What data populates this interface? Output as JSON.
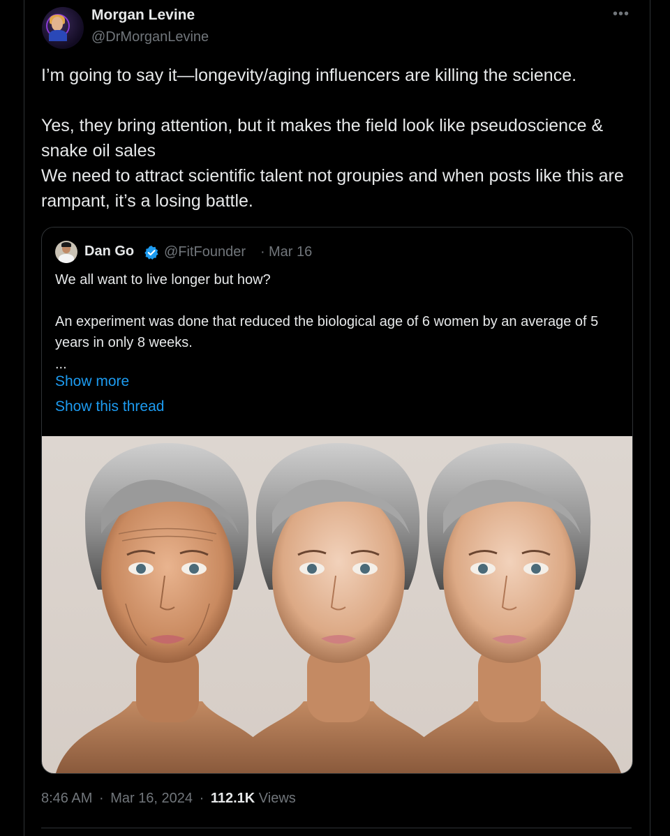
{
  "post": {
    "author": {
      "name": "Morgan Levine",
      "handle": "@DrMorganLevine"
    },
    "more_icon": "more-horizontal-icon",
    "text": {
      "p1": "I’m going to say it—longevity/aging influencers are killing the science.",
      "p2": "Yes, they bring attention, but it makes the field look like pseudoscience & snake oil sales",
      "p3": "We need to attract scientific talent not groupies and when posts like this are rampant, it’s a losing battle."
    },
    "meta": {
      "time": "8:46 AM",
      "separator": "·",
      "date": "Mar 16, 2024",
      "views_count": "112.1K",
      "views_label": "Views"
    }
  },
  "quote": {
    "author": {
      "name": "Dan Go",
      "handle": "@FitFounder",
      "separator": "·",
      "date": "Mar 16",
      "verified_icon": "verified-badge-icon"
    },
    "text": {
      "p1": "We all want to live longer but how?",
      "p2": "An experiment was done that reduced the biological age of 6 women by an average of 5 years in only 8 weeks.",
      "ellipsis": "..."
    },
    "show_more": "Show more",
    "show_thread": "Show this thread"
  },
  "colors": {
    "background": "#000000",
    "text": "#e7e9ea",
    "secondary": "#71767b",
    "link": "#1d9bf0",
    "border": "#2f3336",
    "verified": "#1d9bf0"
  }
}
